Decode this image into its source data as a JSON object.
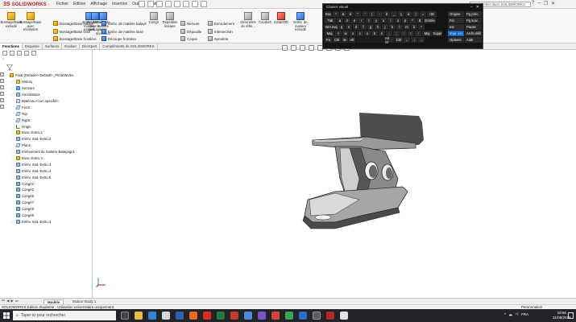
{
  "app": {
    "brand_ds": "3S",
    "brand_name": "SOLIDWORKS",
    "search_placeholder": "Rechercher dans SOLIDWORKS"
  },
  "menu": [
    "Fichier",
    "Edition",
    "Affichage",
    "Insertion",
    "Outils",
    "Fenêtre",
    "?"
  ],
  "ribbon": {
    "boss_base_extrude": "Bossage/Base extrudé",
    "boss_base_revolve": "Bossage/Base avec révolution",
    "boss_swept": "Bossage/Base balayé",
    "boss_loft": "Bossage/Base lissé",
    "boss_boundary": "Bossage/Base frontière",
    "cut_extrude": "Enlèv. de matière extrudé",
    "hole_wizard": "Assistance pour le perçage",
    "cut_revolve": "Enlèv. de matière avec révolution",
    "cut_swept": "Enlèv. de matière balayé",
    "cut_loft": "Enlèv. de matière lissé",
    "cut_boundary": "Découpe frontière",
    "fillet": "Congé",
    "linear_pattern": "Répétition linéaire",
    "rib": "Nervure",
    "draft": "Dépouille",
    "shell": "Coque",
    "wrap": "Enroulement",
    "intersect": "Intersection",
    "mirror": "Symétrie",
    "ref_geometry": "Géométrie de référ...",
    "curves": "Courbes",
    "instant3d": "Instant3D",
    "cut_extrude_b": "Enlèv. de matière extrudé"
  },
  "tabs": [
    "Fonctions",
    "Esquisse",
    "Surfaces",
    "Evaluer",
    "DimXpert",
    "Compléments de SOLIDWORKS"
  ],
  "tree": {
    "root": "Final (Default<<Default>_PhotoWorks",
    "items": [
      {
        "label": "History",
        "icon": "folder"
      },
      {
        "label": "Sensors",
        "icon": "sensor"
      },
      {
        "label": "Annotations",
        "icon": "annot"
      },
      {
        "label": "Matériau <non spécifié>",
        "icon": "mat"
      },
      {
        "label": "Front",
        "icon": "plane"
      },
      {
        "label": "Top",
        "icon": "plane"
      },
      {
        "label": "Right",
        "icon": "plane"
      },
      {
        "label": "Origin",
        "icon": "origin"
      },
      {
        "label": "Boss.-Extru.2",
        "icon": "feat"
      },
      {
        "label": "Enlèv. mat.-Extru.2",
        "icon": "cut"
      },
      {
        "label": "Plan1",
        "icon": "plane"
      },
      {
        "label": "Enlèvement de matière-Balayage1",
        "icon": "cut"
      },
      {
        "label": "Boss.-Extru.3",
        "icon": "feat"
      },
      {
        "label": "Enlèv. mat.-Extru.3",
        "icon": "cut"
      },
      {
        "label": "Enlèv. mat.-Extru.4",
        "icon": "cut"
      },
      {
        "label": "Enlèv. mat.-Extru.5",
        "icon": "cut"
      },
      {
        "label": "Congé1",
        "icon": "fillet"
      },
      {
        "label": "Congé2",
        "icon": "fillet"
      },
      {
        "label": "Congé6",
        "icon": "fillet"
      },
      {
        "label": "Congé7",
        "icon": "fillet"
      },
      {
        "label": "Congé8",
        "icon": "fillet"
      },
      {
        "label": "Congé9",
        "icon": "fillet"
      },
      {
        "label": "Enlèv. mat.-Extru.3",
        "icon": "cut"
      }
    ]
  },
  "osk": {
    "title": "Clavier visuel",
    "row1": [
      "Esc",
      "²",
      "&",
      "é",
      "\"",
      "'",
      "(",
      "-",
      "è",
      "_",
      "ç",
      "à",
      ")",
      "=",
      "⌫"
    ],
    "row2": [
      "Tab",
      "a",
      "z",
      "e",
      "r",
      "t",
      "y",
      "u",
      "i",
      "o",
      "p",
      "^",
      "$",
      "Entrée"
    ],
    "row3": [
      "Verr.maj",
      "q",
      "s",
      "d",
      "f",
      "g",
      "h",
      "j",
      "k",
      "l",
      "m",
      "ù",
      "*"
    ],
    "row4": [
      "Maj",
      "<",
      "w",
      "x",
      "c",
      "v",
      "b",
      "n",
      ",",
      ";",
      ":",
      "!",
      "↑",
      "Maj",
      "Suppr"
    ],
    "row5": [
      "Fn",
      "Ctrl",
      "⊞",
      "Alt",
      "",
      "Alt Gr",
      "Ctrl",
      "←",
      "↓",
      "→"
    ],
    "right": {
      "home": "Origine",
      "pgup": "Pg préc.",
      "end": "Fin",
      "pgdn": "Pg suiv.",
      "ins": "Ins",
      "pause": "Pause",
      "prtscn": "Impr. écr.",
      "scrlk": "Arrêt défil",
      "options": "Options",
      "help": "Aide"
    }
  },
  "bottom": {
    "model_tab": "Modèle",
    "motion_tab": "Motion Study 1",
    "status": "SOLIDWORKS Edition étudiante - Utilisation universitaire uniquement",
    "custom": "Personnalisé"
  },
  "taskbar": {
    "search": "Taper ici pour rechercher",
    "lang": "FRA",
    "time": "19:56",
    "date": "31/08/2019"
  },
  "colors": {
    "brand_red": "#d21f1f",
    "osk_bg": "#141414",
    "osk_highlight": "#0b67c2",
    "taskbar_bg": "#222428"
  }
}
